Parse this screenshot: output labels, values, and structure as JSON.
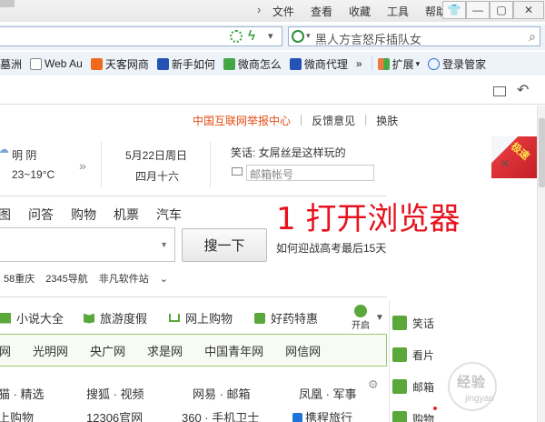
{
  "menu": {
    "items": [
      "文件",
      "查看",
      "收藏",
      "工具",
      "帮助"
    ]
  },
  "window": {
    "controls": [
      "shirt-icon",
      "minimize-icon",
      "maximize-icon",
      "close-icon"
    ]
  },
  "address_bar": {
    "value": ""
  },
  "search_bar": {
    "text": "黑人方言怒斥插队女"
  },
  "favorites": {
    "items": [
      {
        "label": "墓洲",
        "icon": "folder-icon",
        "color": "#e9b540"
      },
      {
        "label": "Web Au",
        "icon": "page-icon",
        "color": "#ffffff"
      },
      {
        "label": "天客网商",
        "icon": "xue-icon",
        "color": "#f06a1e"
      },
      {
        "label": "新手如何",
        "icon": "paw-icon",
        "color": "#2452b5"
      },
      {
        "label": "微商怎么",
        "icon": "wei-icon",
        "color": "#42a642"
      },
      {
        "label": "微商代理",
        "icon": "paw-icon",
        "color": "#2452b5"
      }
    ],
    "extend_label": "扩展",
    "login_label": "登录管家"
  },
  "page": {
    "top_links": {
      "report": "中国互联网举报中心",
      "feedback": "反馈意见",
      "skin": "换肤"
    },
    "weather": {
      "line1": "明 阴",
      "line2": "23~19°C"
    },
    "date": {
      "line1": "5月22日周日",
      "line2": "四月十六"
    },
    "joke": "笑话: 女屌丝是这样玩的",
    "mail_placeholder": "邮箱帐号",
    "promo_text": "极速",
    "nav_tabs": [
      "图",
      "问答",
      "购物",
      "机票",
      "汽车"
    ],
    "annotation": "1 打开浏览器",
    "search_button": "搜一下",
    "hot_search": "如何迎战高考最后15天",
    "quick_links": [
      "58重庆",
      "2345导航",
      "非凡软件站",
      "⌄"
    ],
    "categories": [
      {
        "label": "小说大全",
        "color": "#5aa73a"
      },
      {
        "label": "旅游度假",
        "color": "#5aa73a"
      },
      {
        "label": "网上购物",
        "color": "#5aa73a"
      },
      {
        "label": "好药特惠",
        "color": "#5aa73a"
      }
    ],
    "kaiqi": "开启",
    "sites": [
      "网",
      "光明网",
      "央广网",
      "求是网",
      "中国青年网",
      "网信网"
    ],
    "links_row1": [
      "猫 · 精选",
      "搜狐 · 视频",
      "网易 · 邮箱",
      "凤凰 · 军事"
    ],
    "links_row2": [
      "上购物",
      "12306官网",
      "360 · 手机卫士",
      "携程旅行"
    ],
    "side_items": [
      {
        "label": "笑话",
        "color": "#5aa73a"
      },
      {
        "label": "看片",
        "color": "#5aa73a"
      },
      {
        "label": "邮箱",
        "color": "#5aa73a"
      },
      {
        "label": "购物",
        "color": "#5aa73a"
      }
    ],
    "watermark": {
      "text": "经验",
      "sub": "jingyan"
    }
  },
  "colors": {
    "accent_red": "#e6121d",
    "report_orange": "#e24d12",
    "green": "#5aa73a"
  }
}
